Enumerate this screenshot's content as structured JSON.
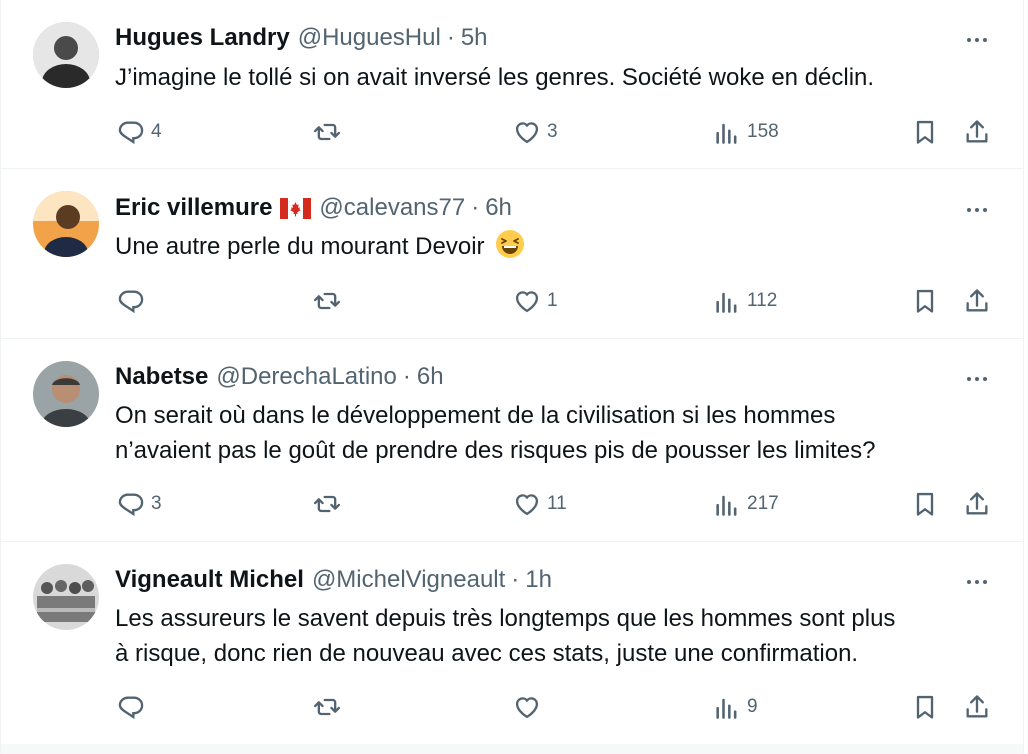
{
  "replies": [
    {
      "name": "Hugues Landry",
      "handle": "@HuguesHul",
      "dot": "·",
      "time": "5h",
      "text": "J’imagine le tollé si on avait inversé les genres. Société woke en déclin.",
      "replies_count": "4",
      "retweets_count": "",
      "likes_count": "3",
      "views_count": "158"
    },
    {
      "name": "Eric villemure",
      "handle": "@calevans77",
      "dot": "·",
      "time": "6h",
      "text": "Une autre perle du mourant Devoir",
      "replies_count": "",
      "retweets_count": "",
      "likes_count": "1",
      "views_count": "112"
    },
    {
      "name": "Nabetse",
      "handle": "@DerechaLatino",
      "dot": "·",
      "time": "6h",
      "text_line1": "On serait où dans le développement de la civilisation si les hommes",
      "text_line2": "n’avaient pas le goût de prendre des risques pis de pousser les limites?",
      "replies_count": "3",
      "retweets_count": "",
      "likes_count": "11",
      "views_count": "217"
    },
    {
      "name": "Vigneault Michel",
      "handle": "@MichelVigneault",
      "dot": "·",
      "time": "1h",
      "text_line1": "Les assureurs le savent depuis très longtemps que les hommes sont plus",
      "text_line2": "à risque, donc rien de nouveau avec ces stats, juste une confirmation.",
      "replies_count": "",
      "retweets_count": "",
      "likes_count": "",
      "views_count": "9"
    }
  ],
  "icons": {
    "reply": "reply-icon",
    "retweet": "retweet-icon",
    "like": "like-icon",
    "views": "views-icon",
    "bookmark": "bookmark-icon",
    "share": "share-icon",
    "more": "more-icon",
    "flag": "canada-flag-icon",
    "emoji": "grinning-squinting-face-icon"
  },
  "colors": {
    "text": "#0f1419",
    "secondary": "#536471",
    "divider": "#eff3f4",
    "flag_red": "#d52b1e"
  }
}
